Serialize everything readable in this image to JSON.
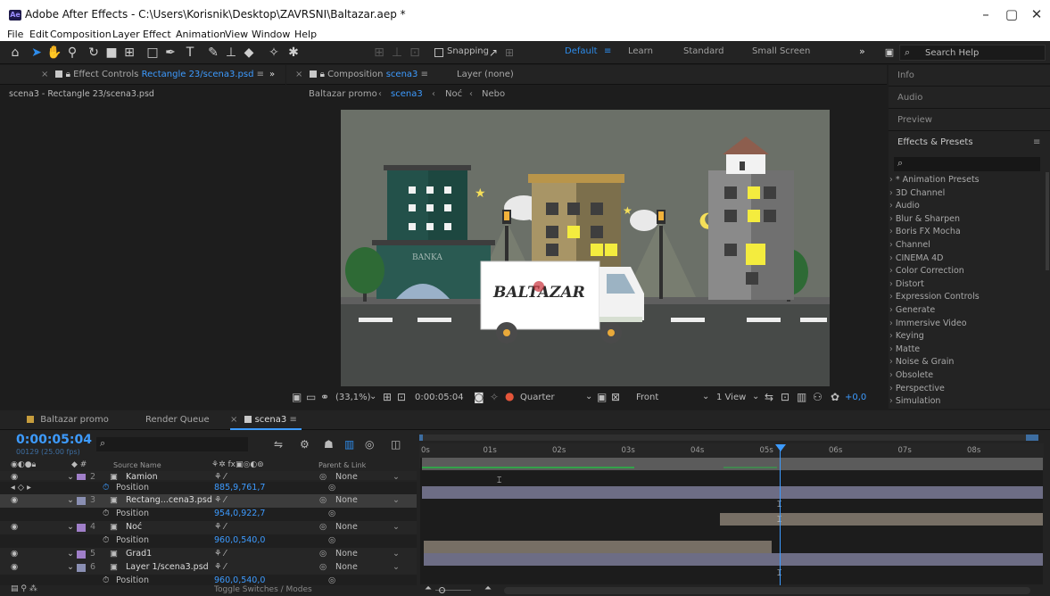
{
  "window": {
    "title": "Adobe After Effects - C:\\Users\\Korisnik\\Desktop\\ZAVRSNI\\Baltazar.aep *",
    "logo": "Ae",
    "min": "–",
    "max": "▢",
    "close": "✕"
  },
  "menu": [
    "File",
    "Edit",
    "Composition",
    "Layer",
    "Effect",
    "Animation",
    "View",
    "Window",
    "Help"
  ],
  "toolbar": {
    "snapping": "Snapping",
    "workspaces": [
      "Default",
      "Learn",
      "Standard",
      "Small Screen"
    ],
    "more": "»",
    "search_placeholder": "Search Help"
  },
  "effect_controls": {
    "tab_prefix": "Effect Controls",
    "tab_layer": "Rectangle 23/scena3.psd",
    "more": "»",
    "subtitle": "scena3 - Rectangle 23/scena3.psd"
  },
  "composition": {
    "tab_prefix": "Composition",
    "tab_comp": "scena3",
    "layer_tab": "Layer (none)",
    "breadcrumbs": [
      "Baltazar promo",
      "scena3",
      "Noć",
      "Nebo"
    ],
    "bank_sign": "BANKA",
    "truck_brand": "BALTAZAR",
    "footer": {
      "zoom": "(33,1%)",
      "time": "0:00:05:04",
      "resolution": "Quarter",
      "view": "Front",
      "views": "1 View",
      "exposure": "+0,0"
    }
  },
  "right_panel": {
    "sections": [
      "Info",
      "Audio",
      "Preview",
      "Effects & Presets"
    ],
    "search_placeholder": "",
    "effects": [
      "* Animation Presets",
      "3D Channel",
      "Audio",
      "Blur & Sharpen",
      "Boris FX Mocha",
      "Channel",
      "CINEMA 4D",
      "Color Correction",
      "Distort",
      "Expression Controls",
      "Generate",
      "Immersive Video",
      "Keying",
      "Matte",
      "Noise & Grain",
      "Obsolete",
      "Perspective",
      "Simulation"
    ]
  },
  "timeline": {
    "tabs": [
      "Baltazar promo",
      "Render Queue",
      "scena3"
    ],
    "timecode": "0:00:05:04",
    "fps": "00129 (25.00 fps)",
    "col_source": "Source Name",
    "col_parent": "Parent & Link",
    "ruler": [
      "0s",
      "01s",
      "02s",
      "03s",
      "04s",
      "05s",
      "06s",
      "07s",
      "08s"
    ],
    "layers": [
      {
        "num": "2",
        "name": "Kamion",
        "prop": "Position",
        "value": "885,9,761,7",
        "parent": "None",
        "color": "#a07fc9"
      },
      {
        "num": "3",
        "name": "Rectang...cena3.psd",
        "prop": "Position",
        "value": "954,0,922,7",
        "parent": "None",
        "color": "#8a8fb3"
      },
      {
        "num": "4",
        "name": "Noć",
        "prop": "Position",
        "value": "960,0,540,0",
        "parent": "None",
        "color": "#a07fc9"
      },
      {
        "num": "5",
        "name": "Grad1",
        "prop": "",
        "value": "",
        "parent": "None",
        "color": "#a07fc9"
      },
      {
        "num": "6",
        "name": "Layer 1/scena3.psd",
        "prop": "Position",
        "value": "960,0,540,0",
        "parent": "None",
        "color": "#8a8fb3"
      }
    ],
    "toggle": "Toggle Switches / Modes"
  },
  "colors": {
    "accent": "#2d8ceb",
    "playhead": "#3d9bff",
    "sky": "#6b7068",
    "road": "#474a48"
  }
}
